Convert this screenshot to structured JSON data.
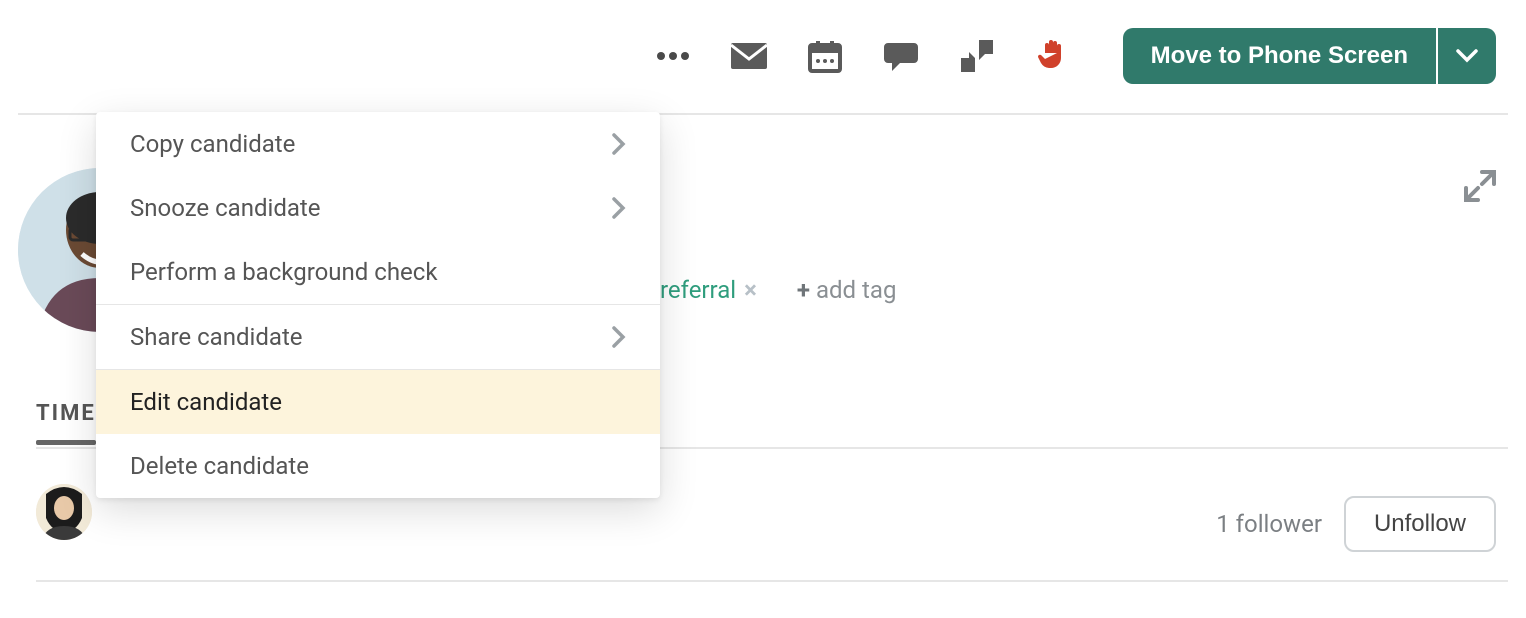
{
  "toolbar": {
    "move_label": "Move to Phone Screen"
  },
  "dropdown": {
    "items": [
      {
        "label": "Copy candidate",
        "chevron": true
      },
      {
        "label": "Snooze candidate",
        "chevron": true
      },
      {
        "label": "Perform a background check",
        "chevron": false
      }
    ],
    "share_label": "Share candidate",
    "edit_label": "Edit candidate",
    "delete_label": "Delete candidate"
  },
  "tabs": {
    "timeline_label": "TIME"
  },
  "tags": {
    "referral": "referral",
    "add_tag_label": "add tag"
  },
  "followers": {
    "count_label": "1 follower",
    "unfollow_label": "Unfollow"
  }
}
